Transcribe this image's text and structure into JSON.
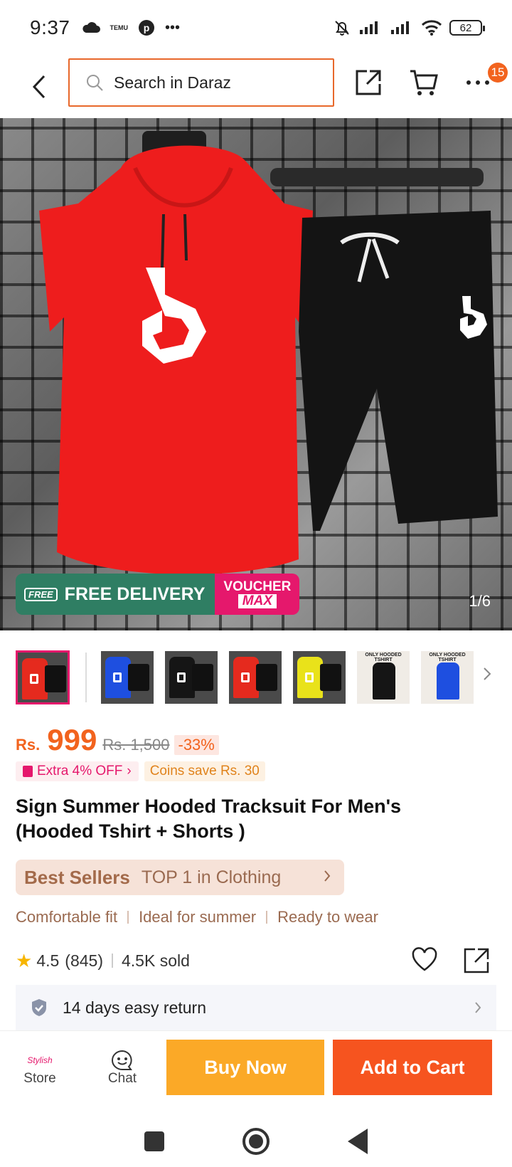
{
  "status_bar": {
    "time": "9:37",
    "temu_label": "TEMU",
    "battery": "62"
  },
  "search": {
    "placeholder": "Search in Daraz"
  },
  "header": {
    "more_badge": "15"
  },
  "hero": {
    "counter": "1/6",
    "free_delivery": "FREE DELIVERY",
    "free_tag": "FREE",
    "voucher": "VOUCHER",
    "voucher_max": "MAX"
  },
  "thumbnails": [
    {
      "shirt_color": "#e52a1e",
      "selected": true
    },
    {
      "shirt_color": "#1e4fe0",
      "selected": false
    },
    {
      "shirt_color": "#151515",
      "selected": false
    },
    {
      "shirt_color": "#e52a1e",
      "selected": false
    },
    {
      "shirt_color": "#e9e21a",
      "selected": false
    },
    {
      "shirt_color": "#151515",
      "selected": false,
      "caption": "ONLY HOODED TSHIRT"
    },
    {
      "shirt_color": "#1e4fe0",
      "selected": false,
      "caption": "ONLY HOODED TSHIRT"
    }
  ],
  "price": {
    "currency": "Rs.",
    "amount": "999",
    "original": "Rs. 1,500",
    "discount": "-33%"
  },
  "offers": {
    "extra": "Extra 4% OFF",
    "coins": "Coins save Rs. 30"
  },
  "product": {
    "title_line1": "Sign Summer Hooded Tracksuit For Men's",
    "title_line2": "(Hooded Tshirt + Shorts )"
  },
  "best_seller": {
    "label": "Best Sellers",
    "text": "TOP 1 in Clothing"
  },
  "features": [
    "Comfortable fit",
    "Ideal for summer",
    "Ready to wear"
  ],
  "rating": {
    "score": "4.5",
    "count": "(845)",
    "sold": "4.5K sold"
  },
  "return_policy": "14 days easy return",
  "action_bar": {
    "store": "Store",
    "store_logo": "Stylish",
    "chat": "Chat",
    "buy_now": "Buy Now",
    "add_to_cart": "Add to Cart"
  },
  "colors": {
    "brand_orange": "#f6541f",
    "buy_yellow": "#fba927",
    "accent_pink": "#e5186c",
    "search_border": "#e8682b"
  }
}
